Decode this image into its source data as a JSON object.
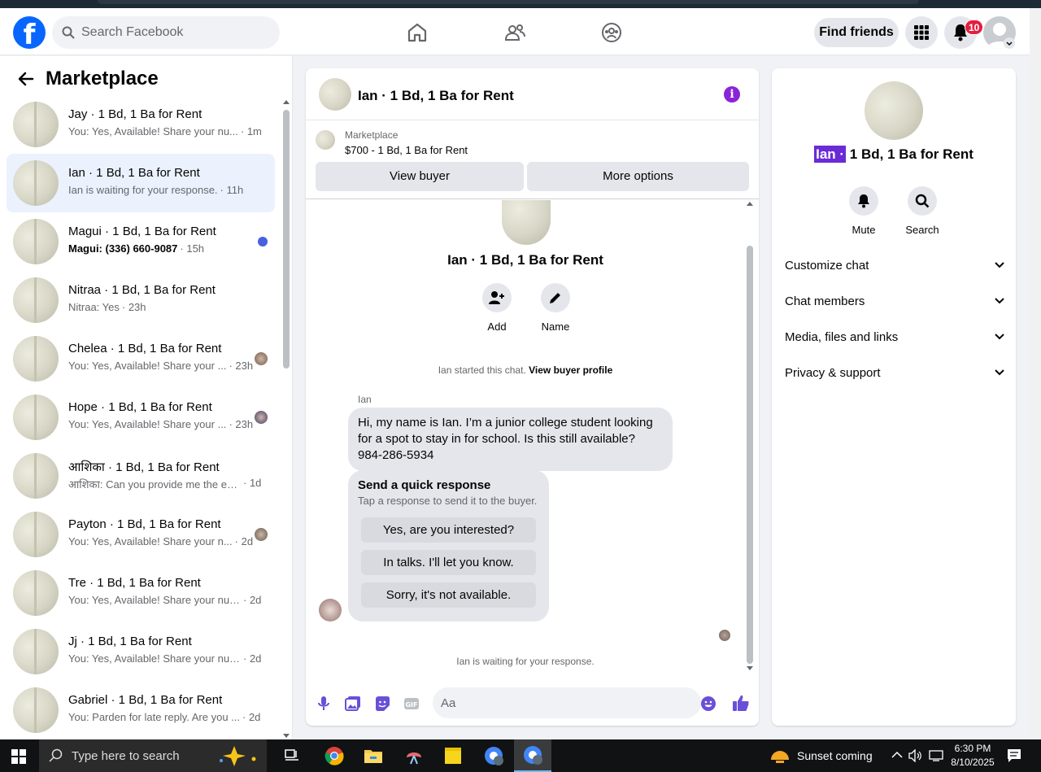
{
  "header": {
    "logo_letter": "f",
    "search_placeholder": "Search Facebook",
    "find_friends_label": "Find friends",
    "notifications_count": "10"
  },
  "marketplace": {
    "title": "Marketplace",
    "conversations": [
      {
        "title": "Jay · 1 Bd, 1 Ba for Rent",
        "preview": "You: Yes, Available! Share your nu...",
        "time": "· 1m",
        "active": false,
        "unread": false
      },
      {
        "title": "Ian · 1 Bd, 1 Ba for Rent",
        "preview": "Ian is waiting for your response.",
        "time": "· 11h",
        "active": true,
        "unread": false
      },
      {
        "title": "Magui · 1 Bd, 1 Ba for Rent",
        "preview": "Magui: (336) 660-9087",
        "time": "· 15h",
        "active": false,
        "unread": true
      },
      {
        "title": "Nitraa · 1 Bd, 1 Ba for Rent",
        "preview": "Nitraa: Yes",
        "time": "· 23h",
        "active": false,
        "unread": false
      },
      {
        "title": "Chelea · 1 Bd, 1 Ba for Rent",
        "preview": "You: Yes, Available! Share your ...",
        "time": "· 23h",
        "active": false,
        "unread": false
      },
      {
        "title": "Hope · 1 Bd, 1 Ba for Rent",
        "preview": "You: Yes, Available! Share your ...",
        "time": "· 23h",
        "active": false,
        "unread": false
      },
      {
        "title": "आशिका · 1 Bd, 1 Ba for Rent",
        "preview": "आशिका: Can you provide me the ex...",
        "time": "· 1d",
        "active": false,
        "unread": false
      },
      {
        "title": "Payton · 1 Bd, 1 Ba for Rent",
        "preview": "You: Yes, Available! Share your n...",
        "time": "· 2d",
        "active": false,
        "unread": false
      },
      {
        "title": "Tre · 1 Bd, 1 Ba for Rent",
        "preview": "You: Yes, Available! Share your num...",
        "time": "· 2d",
        "active": false,
        "unread": false
      },
      {
        "title": "Jj · 1 Bd, 1 Ba for Rent",
        "preview": "You: Yes, Available! Share your num...",
        "time": "· 2d",
        "active": false,
        "unread": false
      },
      {
        "title": "Gabriel · 1 Bd, 1 Ba for Rent",
        "preview": "You: Parden for late reply. Are you ...",
        "time": "· 2d",
        "active": false,
        "unread": false
      }
    ]
  },
  "chat": {
    "title": "Ian · 1 Bd, 1 Ba for Rent",
    "info_glyph": "i",
    "listing_label": "Marketplace",
    "listing_price": "$700 - 1 Bd, 1 Ba for Rent",
    "view_buyer_label": "View buyer",
    "more_options_label": "More options",
    "body_title": "Ian · 1 Bd, 1 Ba for Rent",
    "add_label": "Add",
    "name_label": "Name",
    "started_text": "Ian started this chat.",
    "view_buyer_profile": "View buyer profile",
    "sender_name": "Ian",
    "message": "Hi, my name is Ian. I’m a junior college student looking for a spot to stay in for school. Is this still available? 984-286-5934",
    "quick_title": "Send a quick response",
    "quick_subtitle": "Tap a response to send it to the buyer.",
    "quick_responses": [
      "Yes, are you interested?",
      "In talks. I'll let you know.",
      "Sorry, it's not available."
    ],
    "waiting_text": "Ian is waiting for your response.",
    "input_placeholder": "Aa"
  },
  "details": {
    "name_highlight": "Ian ·",
    "title_rest": " 1 Bd, 1 Ba for Rent",
    "mute_label": "Mute",
    "search_label": "Search",
    "sections": [
      "Customize chat",
      "Chat members",
      "Media, files and links",
      "Privacy & support"
    ]
  },
  "taskbar": {
    "search_placeholder": "Type here to search",
    "weather": "Sunset coming",
    "time": "6:30 PM",
    "date": "8/10/2025"
  },
  "colors": {
    "accent": "#0866ff",
    "messenger_purple": "#8a24d9",
    "active_row": "#ebf2fe",
    "unread_dot": "#4a5ee0",
    "badge": "#e41e3f"
  }
}
